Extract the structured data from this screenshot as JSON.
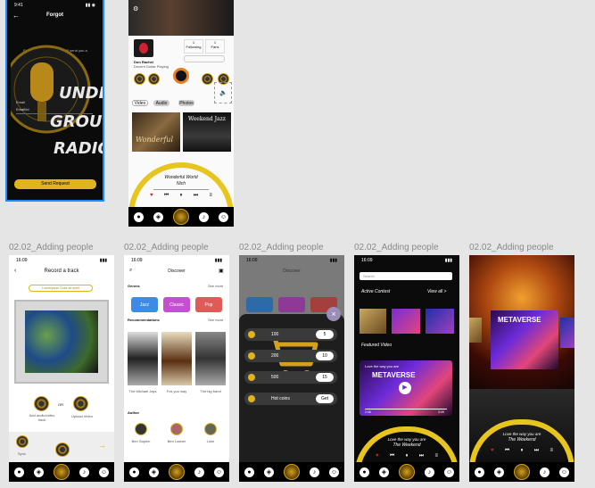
{
  "forgot": {
    "time": "9:41",
    "title": "Forgot",
    "back_icon": "arrow-left-icon",
    "instruction": "Enter your Email below, we'll send you a reset code to your email.",
    "email_label": "Email",
    "email_value": "Email/Id",
    "logo_text": "UNDERGROUND RADIO",
    "send_button": "Send Request"
  },
  "profile": {
    "artist_name": "Don Rachel",
    "artist_sub": "Decent Guitar Playing",
    "stat1_value": "1",
    "stat1_label": "Following",
    "stat2_value": "1",
    "stat2_label": "Fans",
    "tabs": [
      "Video",
      "Audio",
      "Photos"
    ],
    "card1_title": "Wonderful",
    "card2_title": "Weekend Jazz",
    "now_playing_title": "Wonderful World",
    "now_playing_artist": "Nich"
  },
  "labels": {
    "frame1": "02.02_Adding people",
    "frame2": "02.02_Adding people",
    "frame3": "02.02_Adding people",
    "frame4": "02.02_Adding people",
    "frame5": "02.02_Adding people"
  },
  "record": {
    "time": "16:09",
    "title": "Record a track",
    "chip": "Loremipsum Dolor sit amet",
    "add_audio": "Add audio/video track",
    "or": "OR",
    "upload": "Upload Video",
    "sync": "Sync"
  },
  "discover": {
    "time": "16:09",
    "title": "Discover",
    "genres": "Genres",
    "see_more": "See more",
    "genre_items": [
      "Jazz",
      "Classic",
      "Pop"
    ],
    "recommendations": "Recommendations",
    "rec_items": [
      "The Michael Jays",
      "Fus you way",
      "The big band"
    ],
    "author": "Author",
    "authors": [
      "Ben Sapien",
      "Ben Lasher",
      "Luke"
    ]
  },
  "coins": {
    "time": "16:09",
    "title": "Discover",
    "rows": [
      {
        "label": "100",
        "value": "5"
      },
      {
        "label": "200",
        "value": "10"
      },
      {
        "label": "500",
        "value": "15"
      },
      {
        "label": "Hot coins",
        "value": "Get"
      }
    ]
  },
  "live": {
    "time": "16:09",
    "search_placeholder": "Search",
    "active_contest": "Active Contest",
    "view_all": "View all >",
    "featured": "Featured Video",
    "video_caption": "Love the way you are",
    "video_title": "METAVERSE",
    "video_time_start": "2:46",
    "video_time_end": "3:49",
    "np_title": "Love the way you are",
    "np_artist": "The Weekend"
  },
  "player": {
    "title": "METAVERSE",
    "np_title": "Love the way you are",
    "np_artist": "The Weekend"
  },
  "colors": {
    "gold": "#e0b41e",
    "purple_pill": "#c64ed1",
    "blue_pill": "#3d8be6",
    "red_pill": "#e05b57"
  }
}
